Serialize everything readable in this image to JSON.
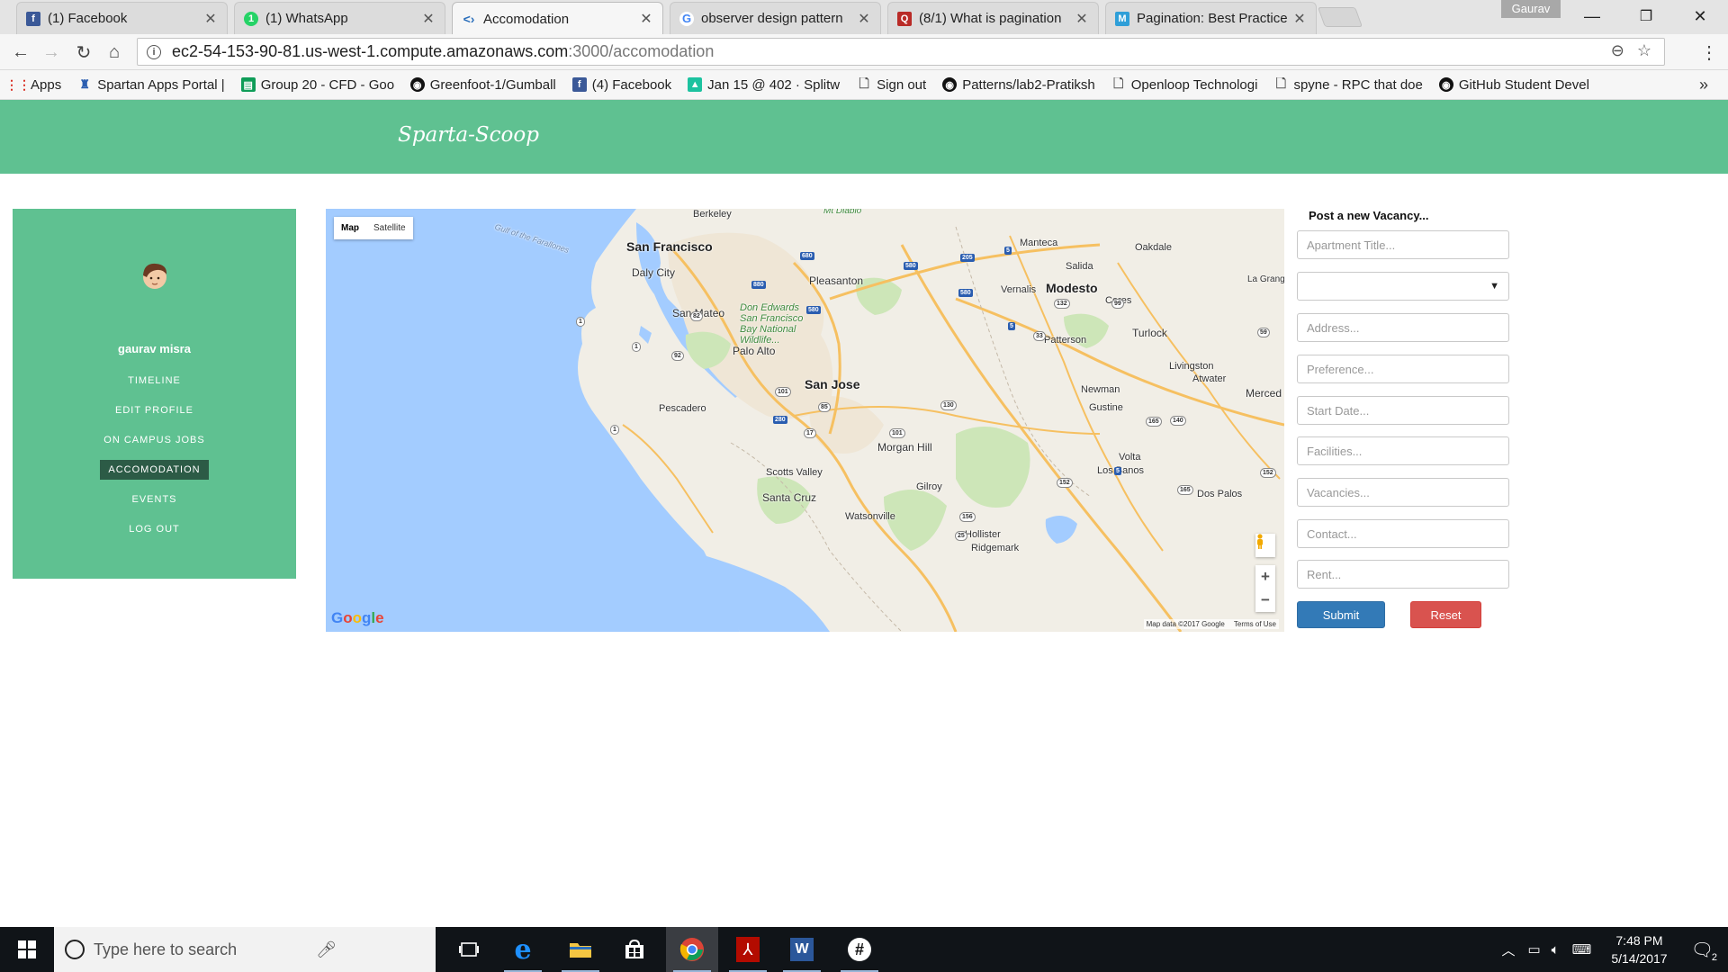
{
  "browser": {
    "tabs": [
      {
        "title": "(1) Facebook",
        "icon": "facebook-icon",
        "color": "#3b5998"
      },
      {
        "title": "(1) WhatsApp",
        "icon": "whatsapp-icon",
        "color": "#25d366"
      },
      {
        "title": "Accomodation",
        "icon": "code-icon",
        "color": "#2a6ebb"
      },
      {
        "title": "observer design pattern",
        "icon": "google-icon",
        "color": "#4285f4"
      },
      {
        "title": "(8/1) What is pagination",
        "icon": "quora-icon",
        "color": "#b92b27"
      },
      {
        "title": "Pagination: Best Practice",
        "icon": "medium-icon",
        "color": "#2f9fd8"
      }
    ],
    "profile": "Gaurav",
    "url_host": "ec2-54-153-90-81.us-west-1.compute.amazonaws.com",
    "url_path": ":3000/accomodation",
    "bookmarks": [
      {
        "label": "Apps",
        "icon": "apps-grid-icon"
      },
      {
        "label": "Spartan Apps Portal |",
        "icon": "spartan-icon"
      },
      {
        "label": "Group 20 - CFD - Goo",
        "icon": "sheets-icon"
      },
      {
        "label": "Greenfoot-1/Gumball",
        "icon": "github-icon"
      },
      {
        "label": "(4) Facebook",
        "icon": "facebook-icon"
      },
      {
        "label": "Jan 15 @ 402 · Splitwi",
        "icon": "splitwise-icon"
      },
      {
        "label": "Sign out",
        "icon": "page-icon"
      },
      {
        "label": "Patterns/lab2-Pratiksh",
        "icon": "github-icon"
      },
      {
        "label": "Openloop Technologi",
        "icon": "page-icon"
      },
      {
        "label": "spyne - RPC that doe",
        "icon": "page-icon"
      },
      {
        "label": "GitHub Student Devel",
        "icon": "github-icon"
      }
    ]
  },
  "site": {
    "brand": "Sparta-Scoop",
    "user": "gaurav misra",
    "nav": [
      "TIMELINE",
      "EDIT PROFILE",
      "ON CAMPUS JOBS",
      "ACCOMODATION",
      "EVENTS",
      "LOG OUT"
    ],
    "active_nav": "ACCOMODATION",
    "accent": "#5fc191"
  },
  "map": {
    "type_buttons": [
      "Map",
      "Satellite"
    ],
    "selected_type": "Map",
    "logo": "Google",
    "attribution": "Map data ©2017 Google",
    "terms": "Terms of Use",
    "labels": [
      {
        "text": "San Francisco",
        "cls": "big"
      },
      {
        "text": "San Jose",
        "cls": "big"
      },
      {
        "text": "Berkeley",
        "cls": "mlabel"
      },
      {
        "text": "Daly City",
        "cls": "mid"
      },
      {
        "text": "San Mateo",
        "cls": "mid"
      },
      {
        "text": "Pleasanton",
        "cls": "mid"
      },
      {
        "text": "Palo Alto",
        "cls": "mid"
      },
      {
        "text": "Modesto",
        "cls": "big"
      },
      {
        "text": "Manteca",
        "cls": "mlabel"
      },
      {
        "text": "Oakdale",
        "cls": "mlabel"
      },
      {
        "text": "Salida",
        "cls": "mlabel"
      },
      {
        "text": "Vernalis",
        "cls": "mlabel"
      },
      {
        "text": "Ceres",
        "cls": "mlabel"
      },
      {
        "text": "Turlock",
        "cls": "mid"
      },
      {
        "text": "Patterson",
        "cls": "mlabel"
      },
      {
        "text": "Livingston",
        "cls": "mlabel"
      },
      {
        "text": "Atwater",
        "cls": "mlabel"
      },
      {
        "text": "Merced",
        "cls": "mid"
      },
      {
        "text": "Newman",
        "cls": "mlabel"
      },
      {
        "text": "Gustine",
        "cls": "mlabel"
      },
      {
        "text": "Morgan Hill",
        "cls": "mid"
      },
      {
        "text": "Volta",
        "cls": "mlabel"
      },
      {
        "text": "Los Banos",
        "cls": "mlabel"
      },
      {
        "text": "Dos Palos",
        "cls": "mlabel"
      },
      {
        "text": "Pescadero",
        "cls": "mlabel"
      },
      {
        "text": "Scotts Valley",
        "cls": "mlabel"
      },
      {
        "text": "Santa Cruz",
        "cls": "mid"
      },
      {
        "text": "Gilroy",
        "cls": "mlabel"
      },
      {
        "text": "Watsonville",
        "cls": "mlabel"
      },
      {
        "text": "Hollister",
        "cls": "mlabel"
      },
      {
        "text": "Ridgemark",
        "cls": "mlabel"
      },
      {
        "text": "La Grang",
        "cls": "mlabel"
      },
      {
        "text": "Mt Diablo",
        "cls": "park"
      },
      {
        "text": "Don Edwards San Francisco Bay National Wildlife...",
        "cls": "park"
      },
      {
        "text": "Gulf of the Farallones",
        "cls": "water"
      }
    ],
    "highways": [
      "680",
      "580",
      "880",
      "205",
      "5",
      "580",
      "280",
      "101",
      "132",
      "33",
      "99",
      "140",
      "165",
      "152",
      "156",
      "25",
      "1",
      "92",
      "17",
      "130",
      "85",
      "82",
      "580",
      "5",
      "59",
      "152",
      "165",
      "101",
      "5",
      "1",
      "1"
    ]
  },
  "form": {
    "title": "Post a new Vacancy...",
    "placeholders": {
      "apartment": "Apartment Title...",
      "address": "Address...",
      "preference": "Preference...",
      "start": "Start Date...",
      "facilities": "Facilities...",
      "vacancies": "Vacancies...",
      "contact": "Contact...",
      "rent": "Rent..."
    },
    "select_value": "",
    "submit": "Submit",
    "reset": "Reset"
  },
  "taskbar": {
    "search_placeholder": "Type here to search",
    "time": "7:48 PM",
    "date": "5/14/2017",
    "notifications": "2"
  }
}
